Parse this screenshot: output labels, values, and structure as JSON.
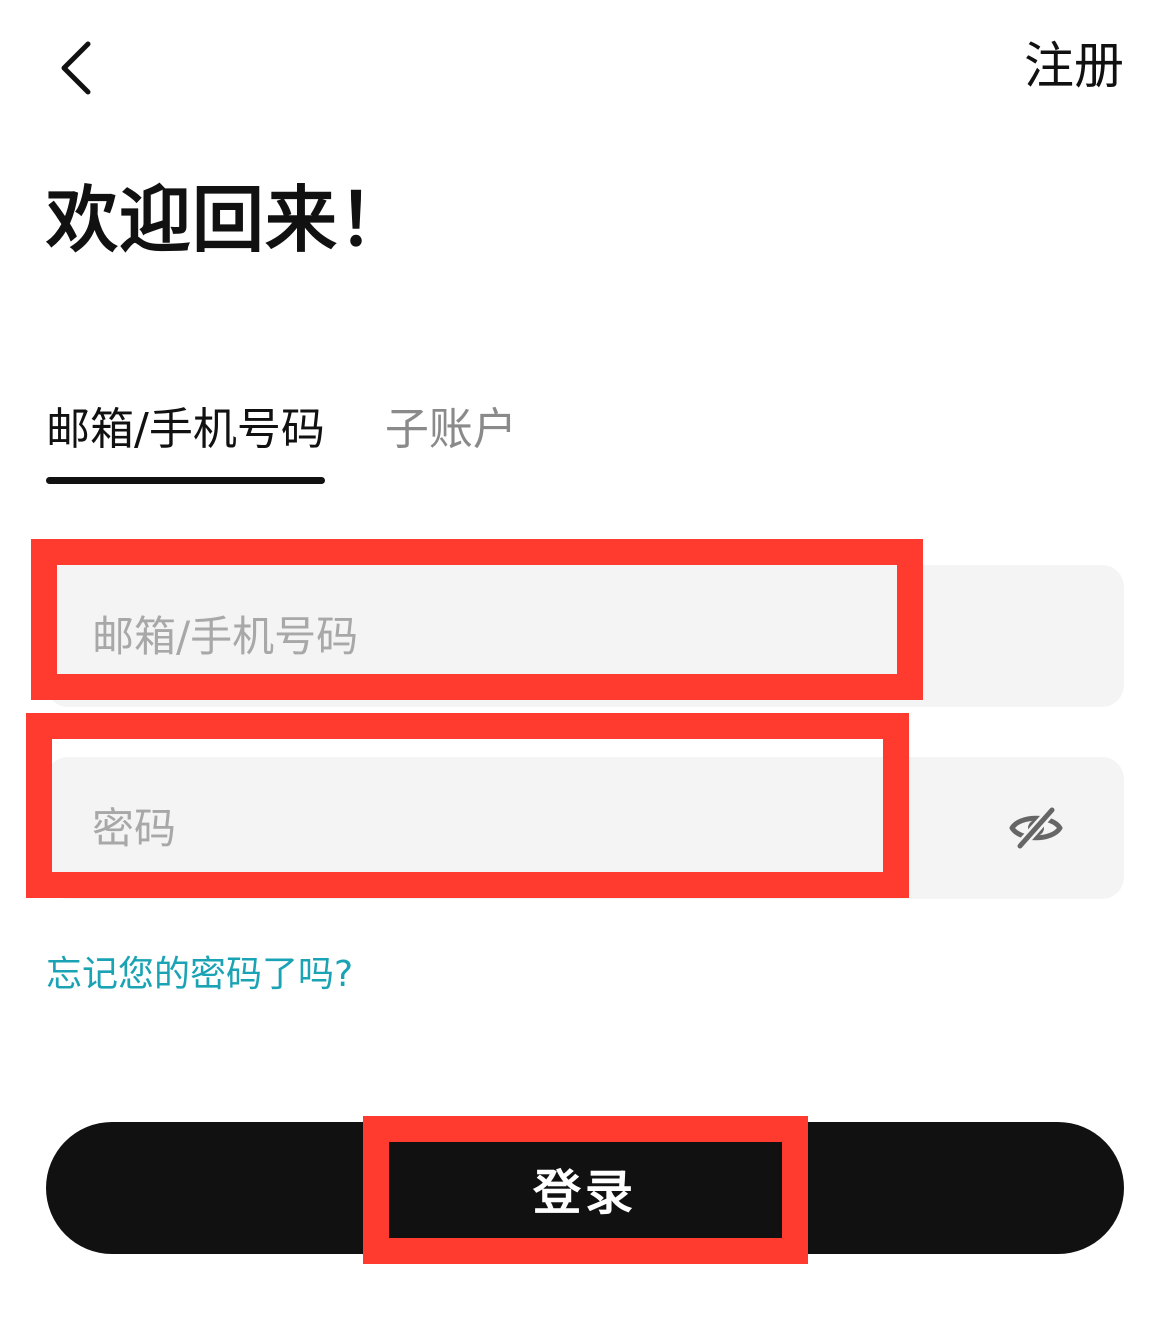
{
  "header": {
    "back_icon": "chevron-left-icon",
    "register_label": "注册"
  },
  "title": "欢迎回来！",
  "tabs": [
    {
      "label": "邮箱/手机号码",
      "active": true
    },
    {
      "label": "子账户",
      "active": false
    }
  ],
  "form": {
    "email": {
      "placeholder": "邮箱/手机号码",
      "value": ""
    },
    "password": {
      "placeholder": "密码",
      "value": "",
      "toggle_icon": "eye-off-icon"
    },
    "forgot_label": "忘记您的密码了吗?",
    "login_label": "登录"
  },
  "colors": {
    "primary": "#111111",
    "field_bg": "#f4f4f4",
    "link": "#1aa3b5",
    "highlight": "#ff3b30",
    "placeholder": "#a8a8a8",
    "inactive_tab": "#8a8a8a"
  }
}
